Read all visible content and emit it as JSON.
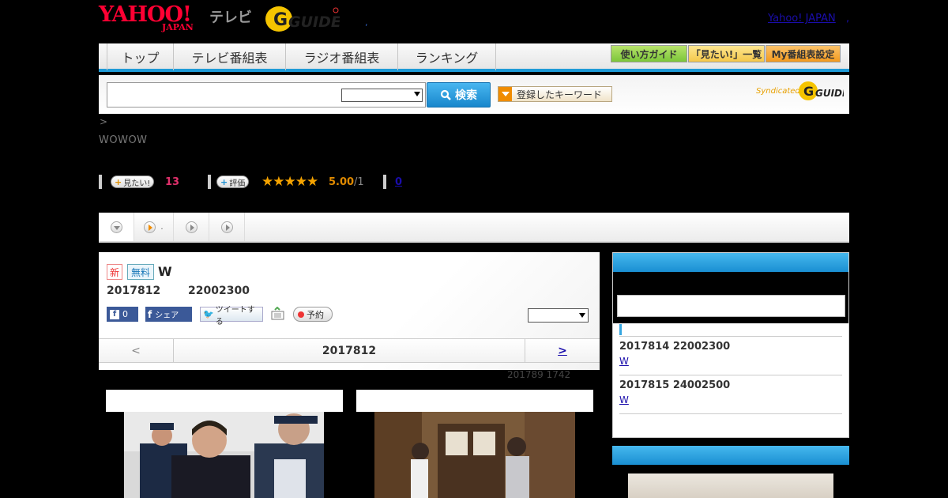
{
  "header": {
    "yahoo_logo": "YAHOO!",
    "yahoo_sub": "JAPAN",
    "tv_label": "テレビ",
    "gguide_logo": "G-GUIDE",
    "yahoo_japan_link": "Yahoo! JAPAN",
    "link_sep": ",",
    "dot": ","
  },
  "nav": {
    "tabs": [
      {
        "label": "トップ"
      },
      {
        "label": "テレビ番組表"
      },
      {
        "label": "ラジオ番組表"
      },
      {
        "label": "ランキング"
      }
    ],
    "buttons": [
      {
        "label": "使い方ガイド",
        "color": "#7cc63a"
      },
      {
        "label": "「見たい!」一覧",
        "color": "#f5c84a"
      },
      {
        "label": "My番組表設定",
        "color": "#f39a1e"
      }
    ],
    "accent": "#1e9ad6"
  },
  "search": {
    "placeholder": "",
    "select_value": "",
    "button_label": "検索",
    "keyword_button": "登録したキーワード",
    "syndicated": "Syndicated"
  },
  "program_meta": {
    "breadcrumb": ">",
    "channel": "WOWOW",
    "want_label": "見たい!",
    "want_count": "13",
    "rate_label": "評価",
    "stars": "★★★★★",
    "score": "5.00",
    "score_denom": "/1",
    "comment_count": "0"
  },
  "tabs_row": {
    "tab2_label": "."
  },
  "program": {
    "badge_new": "新",
    "badge_free": "無料",
    "title": "W",
    "date": "2017812",
    "time": "22002300",
    "fb_like_count": "0",
    "fb_share": "シェア",
    "tweet": "ツイートする",
    "reserve": "予約",
    "nav_prev": "<",
    "nav_date": "2017812",
    "nav_next": ">",
    "updated": "201789  1742"
  },
  "sidebar": {
    "items": [
      {
        "datetime": "2017814  22002300",
        "link": "W"
      },
      {
        "datetime": "2017815  24002500",
        "link": "W"
      }
    ]
  }
}
